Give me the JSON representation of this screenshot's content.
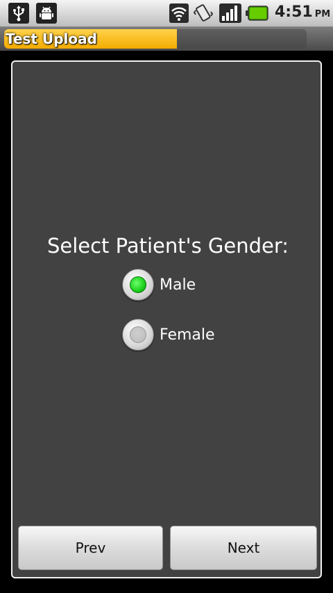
{
  "status_bar": {
    "time": "4:51",
    "ampm": "PM",
    "icons": [
      "usb-icon",
      "android-debug-icon",
      "wifi-icon",
      "vibrate-icon",
      "signal-icon",
      "battery-icon"
    ]
  },
  "title_bar": {
    "title": "Test Upload",
    "progress_fraction": 0.57,
    "progress_color": "#f7b800"
  },
  "form": {
    "prompt": "Select Patient's Gender:",
    "options": [
      {
        "label": "Male",
        "selected": true
      },
      {
        "label": "Female",
        "selected": false
      }
    ],
    "selected_color": "#22dd22"
  },
  "buttons": {
    "prev_label": "Prev",
    "next_label": "Next"
  }
}
